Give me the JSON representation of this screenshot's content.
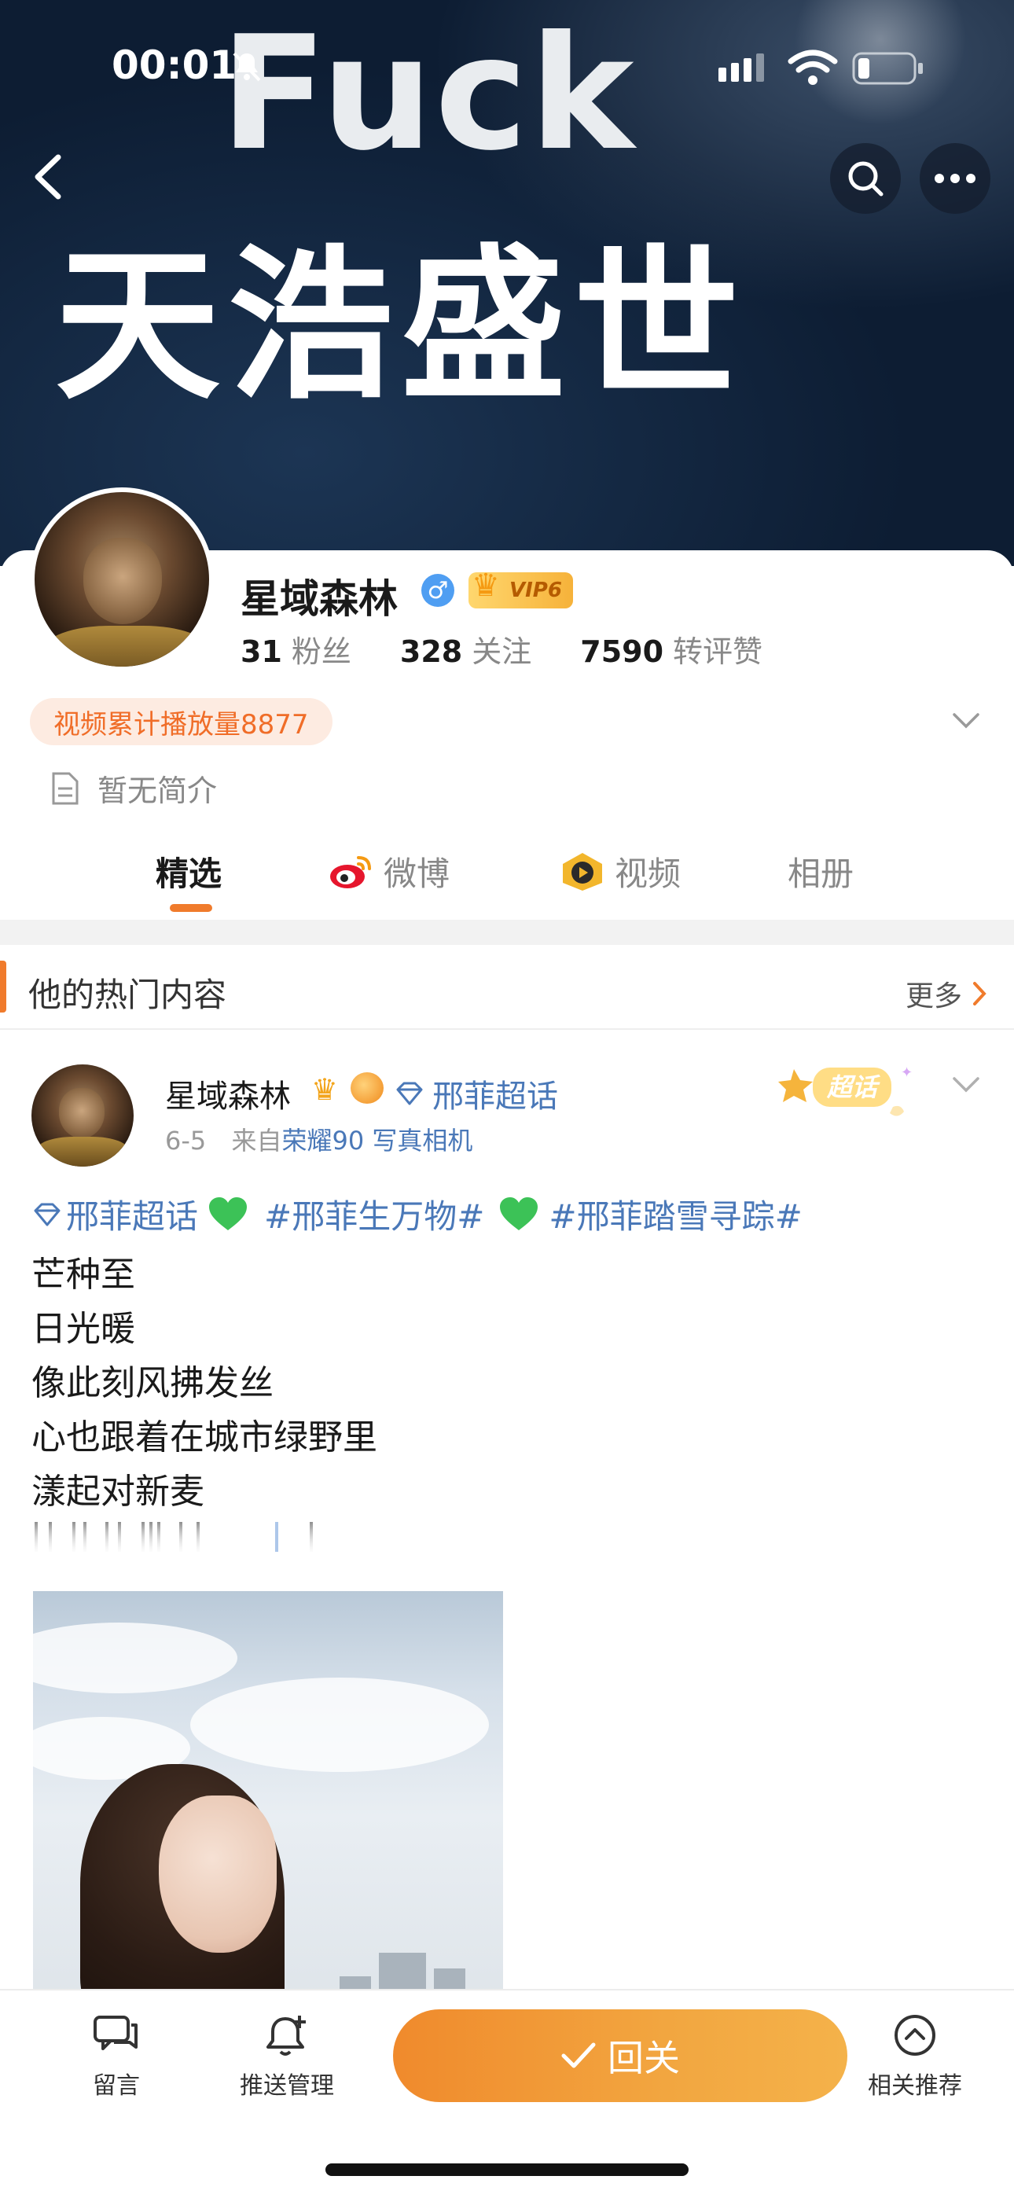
{
  "status_bar": {
    "time": "00:01"
  },
  "banner": {
    "line1": "Fuck",
    "line2": "天浩盛世"
  },
  "profile": {
    "name": "星域森林",
    "gender_symbol": "♂",
    "vip_label": "VIP6",
    "stats": [
      {
        "value": "31",
        "label": "粉丝"
      },
      {
        "value": "328",
        "label": "关注"
      },
      {
        "value": "7590",
        "label": "转评赞"
      }
    ],
    "play_count_pill": "视频累计播放量8877",
    "bio": "暂无简介"
  },
  "tabs": [
    {
      "label": "精选",
      "icon": "none"
    },
    {
      "label": "微博",
      "icon": "weibo-icon"
    },
    {
      "label": "视频",
      "icon": "video-icon"
    },
    {
      "label": "相册",
      "icon": "none"
    }
  ],
  "hot_section": {
    "title": "他的热门内容",
    "more": "更多"
  },
  "post": {
    "author": "星域森林",
    "topic": "邢菲超话",
    "date": "6-5",
    "source_prefix": "来自",
    "source": "荣耀90 写真相机",
    "badge": "超话",
    "tags": {
      "tag1": "邢菲超话",
      "tag2": "#邢菲生万物#",
      "tag3": "#邢菲踏雪寻踪#"
    },
    "lines": [
      "芒种至",
      "日光暖",
      "像此刻风拂发丝",
      "心也跟着在城市绿野里",
      "漾起对新麦"
    ]
  },
  "bottom_bar": {
    "comment": "留言",
    "push": "推送管理",
    "follow": "回关",
    "recommend": "相关推荐"
  },
  "colors": {
    "accent": "#f07b2c",
    "link": "#4a78b8",
    "heart": "#3cc257",
    "vip_gold": "#f6b23a"
  }
}
